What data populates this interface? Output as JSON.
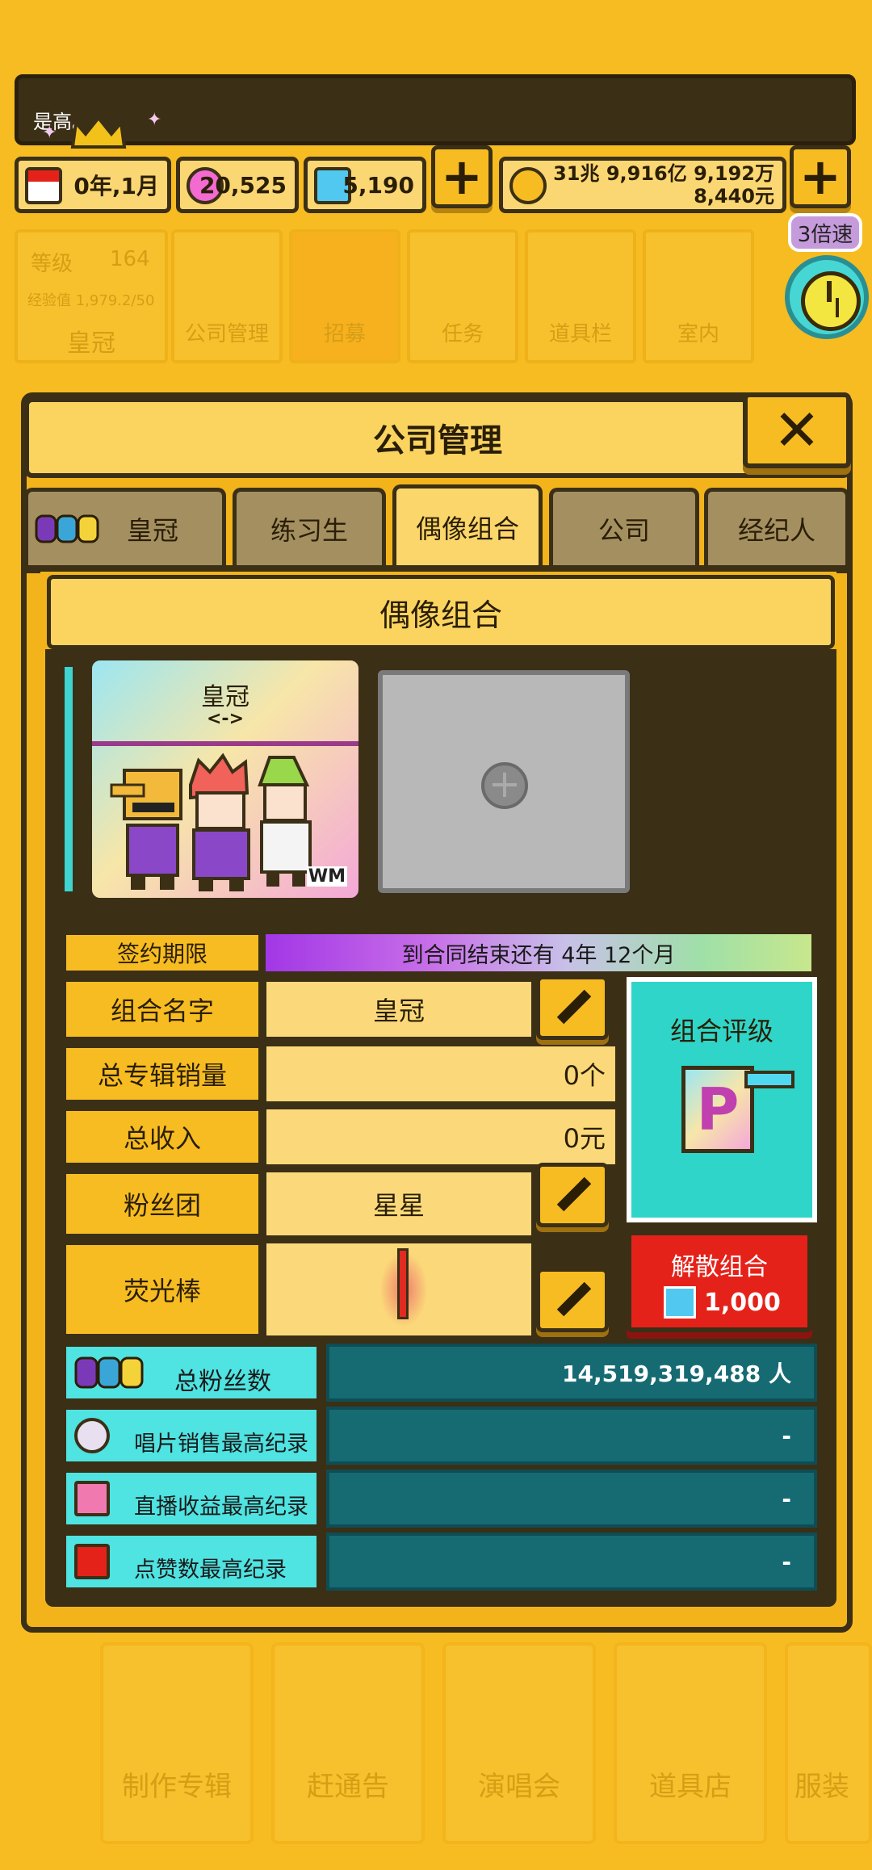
{
  "hud": {
    "ticker_text": "是高。",
    "date": "0年,1月",
    "pink_gems": "20,525",
    "blue_gems": "5,190",
    "money_line1": "31兆 9,916亿 9,192万",
    "money_line2": "8,440元"
  },
  "background_menu": {
    "level_label": "等级",
    "level_value": "164",
    "exp": "经验值 1,979.2/50",
    "company_name": "皇冠",
    "items": [
      "公司管理",
      "招募",
      "任务",
      "道具栏",
      "室内"
    ]
  },
  "speed": {
    "label": "3倍速"
  },
  "modal": {
    "title": "公司管理",
    "tabs": [
      "皇冠",
      "练习生",
      "偶像组合",
      "公司",
      "经纪人"
    ],
    "active_tab": "偶像组合",
    "section_title": "偶像组合",
    "group_card": {
      "name": "皇冠",
      "code": "<->",
      "mark": "WM"
    },
    "rows": {
      "contract_label": "签约期限",
      "contract_value": "到合同结束还有 4年 12个月",
      "name_label": "组合名字",
      "name_value": "皇冠",
      "album_label": "总专辑销量",
      "album_value": "0个",
      "income_label": "总收入",
      "income_value": "0元",
      "fanclub_label": "粉丝团",
      "fanclub_value": "星星",
      "lightstick_label": "荧光棒"
    },
    "rating": {
      "label": "组合评级",
      "grade": "P"
    },
    "disband": {
      "label": "解散组合",
      "cost": "1,000"
    },
    "stats": [
      {
        "label": "总粉丝数",
        "value": "14,519,319,488 人",
        "icon": "fans-icon"
      },
      {
        "label": "唱片销售最高纪录",
        "value": "-",
        "icon": "disc-icon"
      },
      {
        "label": "直播收益最高纪录",
        "value": "-",
        "icon": "music-note-icon"
      },
      {
        "label": "点赞数最高纪录",
        "value": "-",
        "icon": "play-icon"
      }
    ]
  },
  "bottom_menu": [
    "制作专辑",
    "赶通告",
    "演唱会",
    "道具店",
    "服装"
  ],
  "colors": {
    "background": "#f7bc22",
    "outline": "#3b2f16",
    "teal_accent": "#4fe3e1",
    "stat_value_bg": "#166b73",
    "disband_red": "#e5221a"
  }
}
